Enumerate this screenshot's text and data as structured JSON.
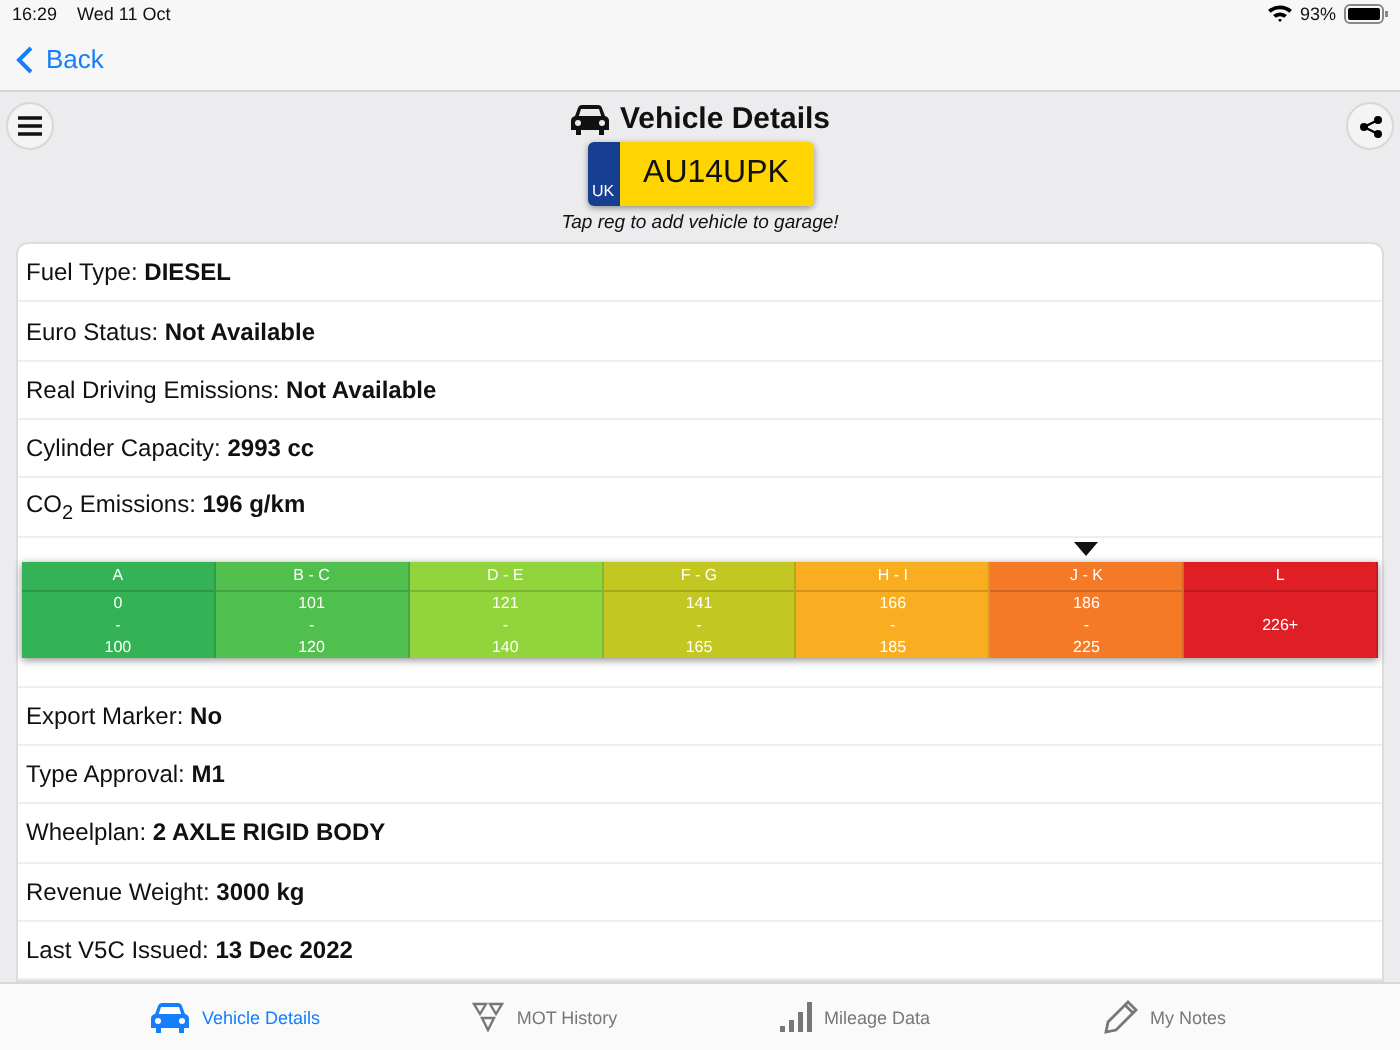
{
  "status_bar": {
    "time": "16:29",
    "date": "Wed 11 Oct",
    "battery": "93%"
  },
  "nav": {
    "back": "Back"
  },
  "header": {
    "title": "Vehicle Details",
    "plate_country": "UK",
    "plate": "AU14UPK",
    "hint": "Tap reg to add vehicle to garage!"
  },
  "details": [
    {
      "kind": "field",
      "text": "Fuel Type: **DIESEL**"
    },
    {
      "kind": "field",
      "text": "Euro Status: **Not Available**"
    },
    {
      "kind": "field",
      "text": "Real Driving Emissions: **Not Available**"
    },
    {
      "kind": "field",
      "text": "Cylinder Capacity: **2993 cc**"
    },
    {
      "kind": "field",
      "text": "CO$_{2}$ Emissions: **196 g/km**"
    },
    {
      "kind": "bands",
      "bands": [
        {
          "band": "A",
          "from": "0",
          "sep": "-",
          "to": "100",
          "color": "#34b356",
          "selected": false
        },
        {
          "band": "B - C",
          "from": "101",
          "sep": "-",
          "to": "120",
          "color": "#50bf4e",
          "selected": false
        },
        {
          "band": "D - E",
          "from": "121",
          "sep": "-",
          "to": "140",
          "color": "#92d43c",
          "selected": false
        },
        {
          "band": "F - G",
          "from": "141",
          "sep": "-",
          "to": "165",
          "color": "#c3c722",
          "selected": false
        },
        {
          "band": "H - I",
          "from": "166",
          "sep": "-",
          "to": "185",
          "color": "#f9ae22",
          "selected": false
        },
        {
          "band": "J - K",
          "from": "186",
          "sep": "-",
          "to": "225",
          "color": "#f47a28",
          "selected": true
        },
        {
          "band": "L",
          "from": "226+",
          "color": "#e01e26",
          "selected": false
        }
      ]
    },
    {
      "kind": "field",
      "text": "Export Marker: **No**"
    },
    {
      "kind": "field",
      "text": "Type Approval: **M1**"
    },
    {
      "kind": "field",
      "text": "Wheelplan: **2 AXLE RIGID BODY**"
    },
    {
      "kind": "field",
      "text": "Revenue Weight: **3000 kg**"
    },
    {
      "kind": "field",
      "text": "Last V5C Issued: **13 Dec 2022**"
    }
  ],
  "tabs": [
    {
      "label": "Vehicle Details",
      "kind": "car",
      "selected": true
    },
    {
      "label": "MOT History",
      "kind": "triangles",
      "selected": false
    },
    {
      "label": "Mileage Data",
      "kind": "bars",
      "selected": false
    },
    {
      "label": "My Notes",
      "kind": "pencil",
      "selected": false
    }
  ]
}
